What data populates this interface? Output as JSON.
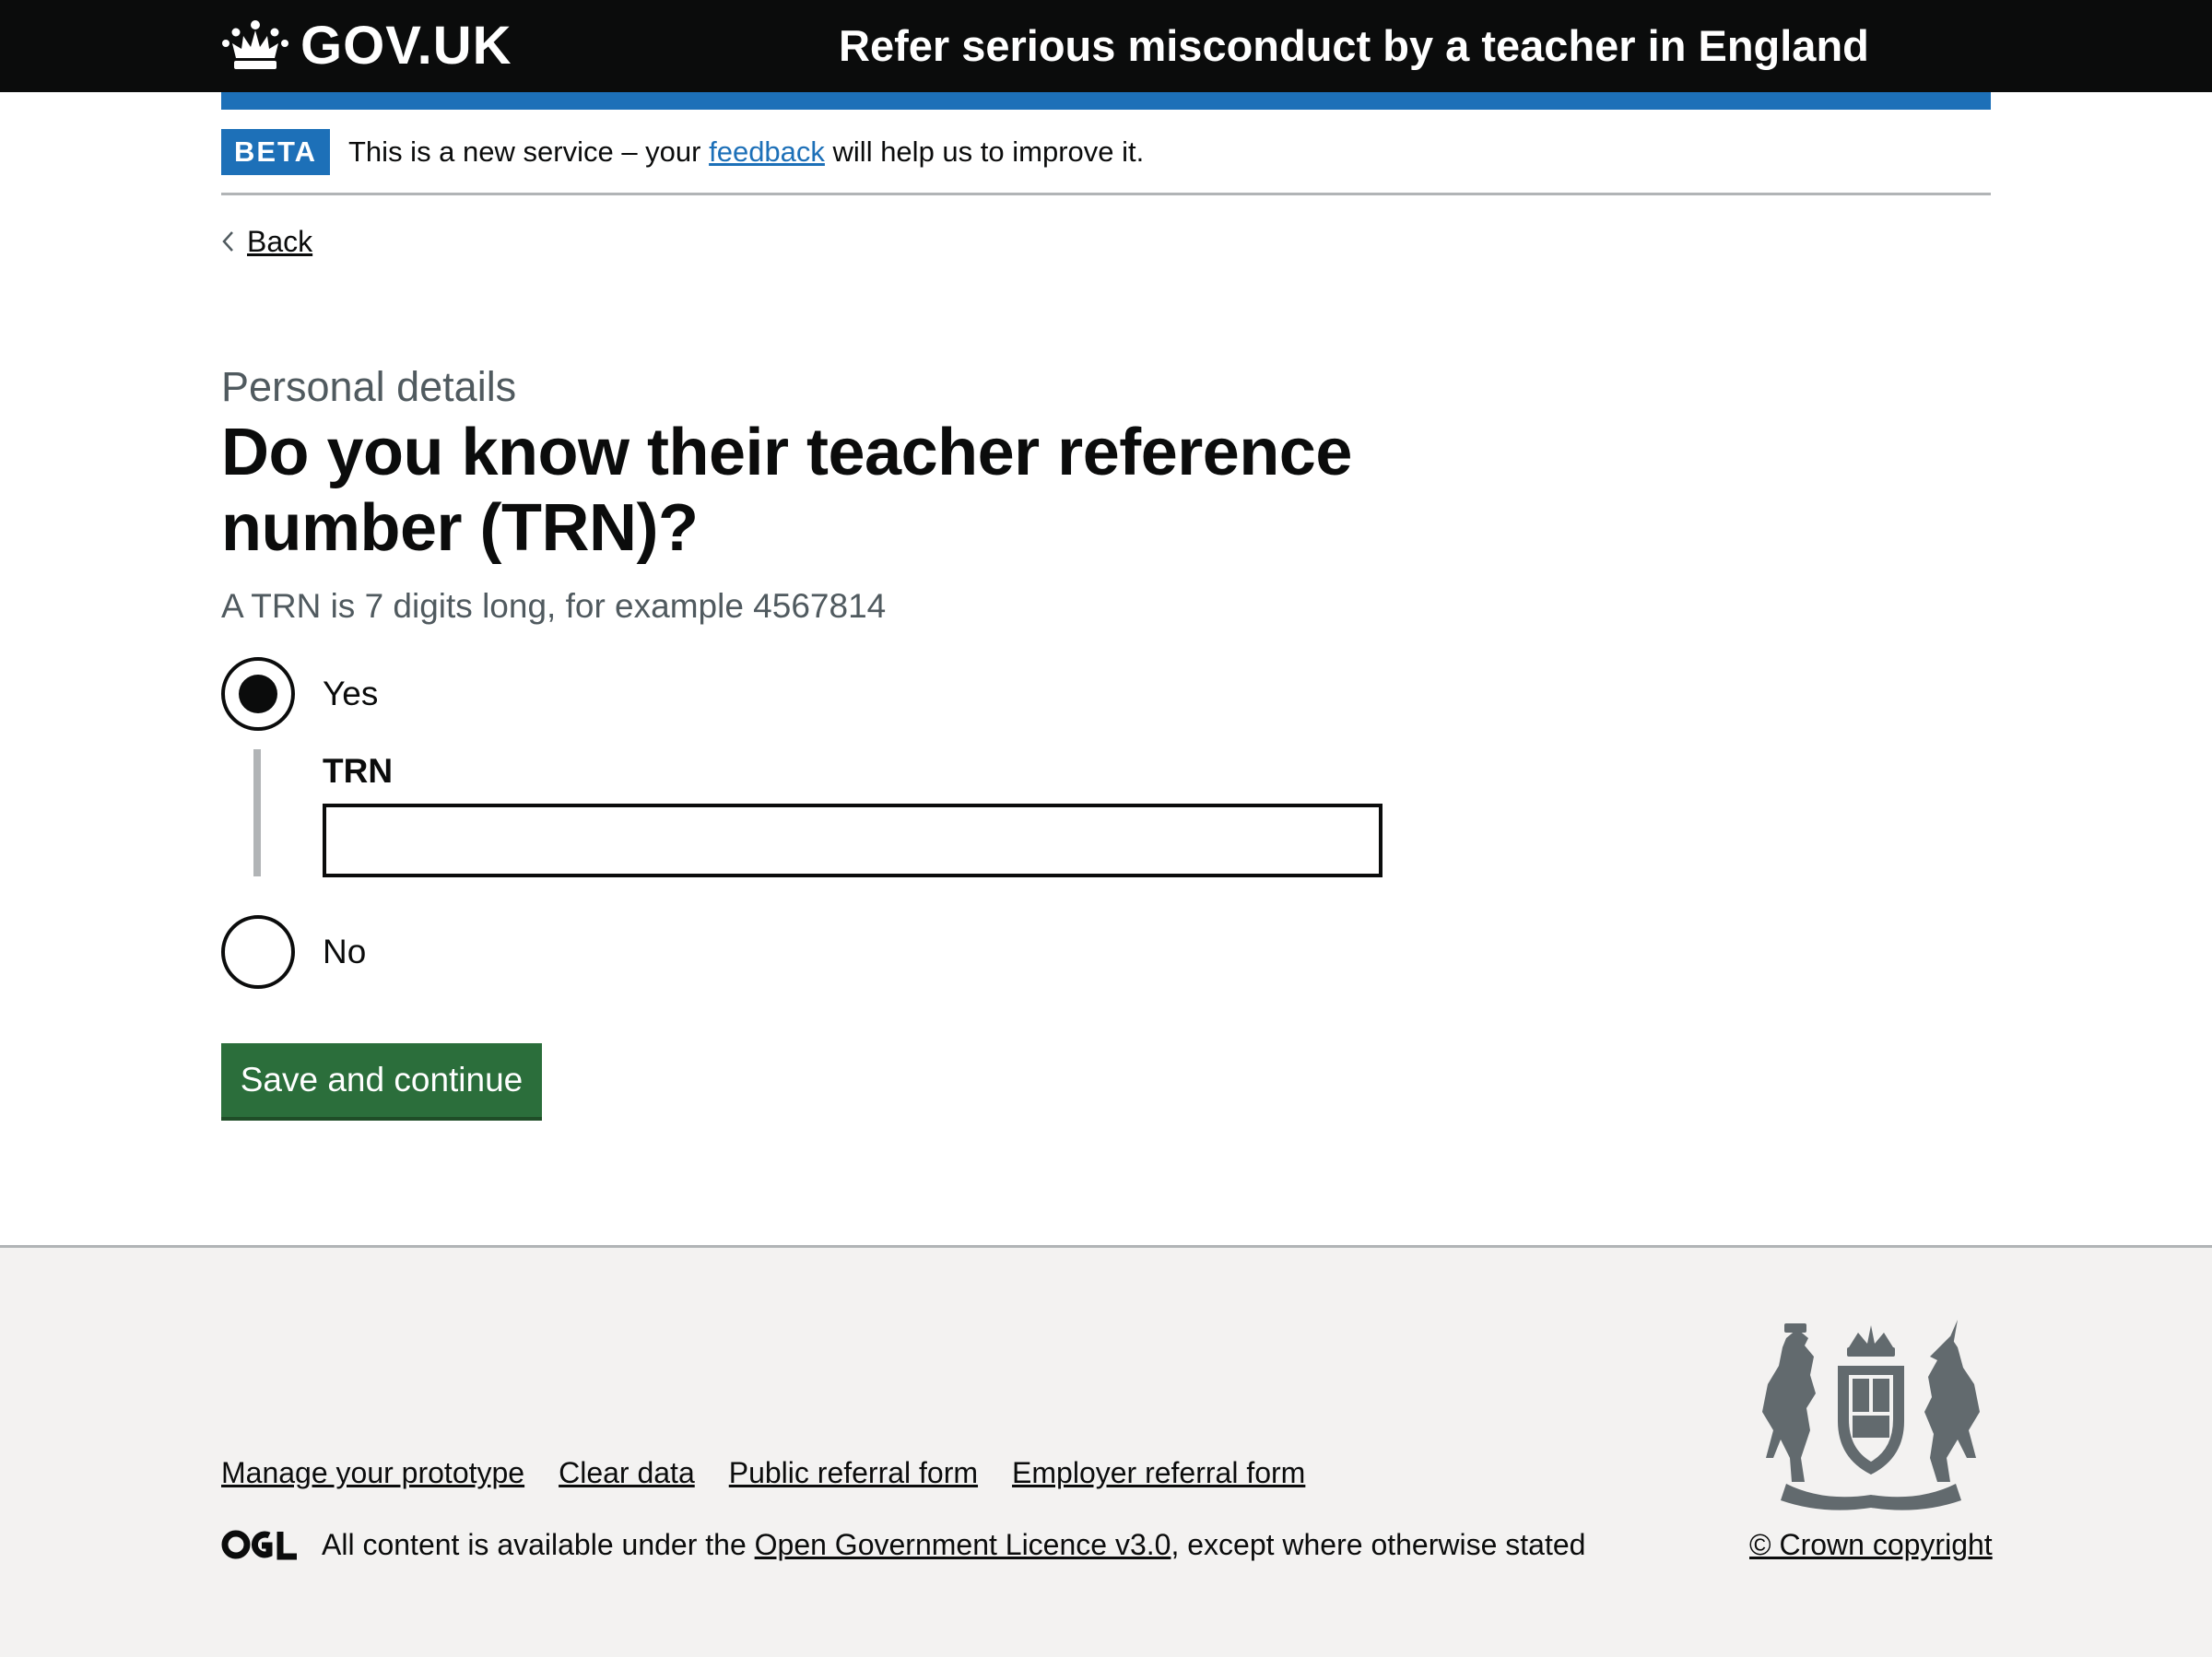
{
  "header": {
    "logo_text": "GOV.UK",
    "service_name": "Refer serious misconduct by a teacher in England"
  },
  "phase_banner": {
    "tag": "BETA",
    "text_before": "This is a new service – your ",
    "link": "feedback",
    "text_after": " will help us to improve it."
  },
  "back_link": "Back",
  "question": {
    "caption": "Personal details",
    "heading": "Do you know their teacher reference number (TRN)?",
    "hint": "A TRN is 7 digits long, for example 4567814",
    "options": [
      {
        "label": "Yes",
        "selected": true
      },
      {
        "label": "No",
        "selected": false
      }
    ],
    "conditional": {
      "label": "TRN",
      "value": ""
    }
  },
  "button": "Save and continue",
  "footer": {
    "links": [
      "Manage your prototype",
      "Clear data",
      "Public referral form",
      "Employer referral form"
    ],
    "licence_before": "All content is available under the ",
    "licence_link": "Open Government Licence v3.0",
    "licence_after": ", except where otherwise stated",
    "copyright": "© Crown copyright"
  },
  "colors": {
    "header_bg": "#0b0c0c",
    "brand_blue": "#1d70b8",
    "button_green": "#2b6e3b",
    "footer_bg": "#f3f2f1",
    "secondary_text": "#505a5f"
  }
}
